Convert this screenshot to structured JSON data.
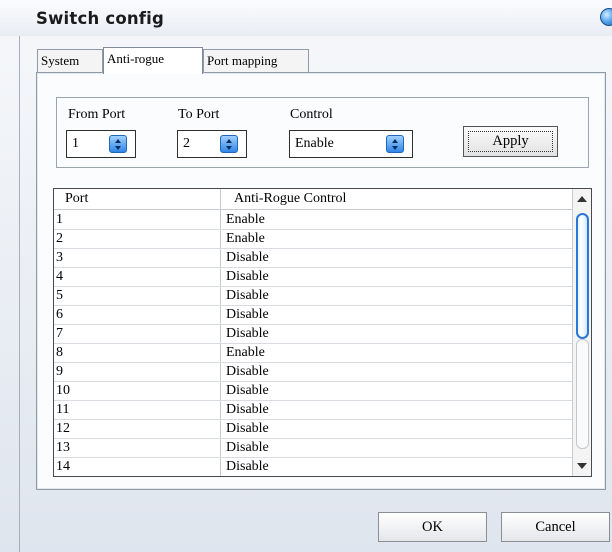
{
  "window": {
    "title": "Switch config"
  },
  "tabs": [
    {
      "label": "System",
      "active": false
    },
    {
      "label": "Anti-rogue",
      "active": true
    },
    {
      "label": "Port mapping",
      "active": false
    }
  ],
  "form": {
    "from_port_label": "From Port",
    "from_port_value": "1",
    "to_port_label": "To Port",
    "to_port_value": "2",
    "control_label": "Control",
    "control_value": "Enable",
    "apply_label": "Apply"
  },
  "table": {
    "headers": [
      "Port",
      "Anti-Rogue Control"
    ],
    "rows": [
      [
        "1",
        "Enable"
      ],
      [
        "2",
        "Enable"
      ],
      [
        "3",
        "Disable"
      ],
      [
        "4",
        "Disable"
      ],
      [
        "5",
        "Disable"
      ],
      [
        "6",
        "Disable"
      ],
      [
        "7",
        "Disable"
      ],
      [
        "8",
        "Enable"
      ],
      [
        "9",
        "Disable"
      ],
      [
        "10",
        "Disable"
      ],
      [
        "11",
        "Disable"
      ],
      [
        "12",
        "Disable"
      ],
      [
        "13",
        "Disable"
      ],
      [
        "14",
        "Disable"
      ]
    ]
  },
  "buttons": {
    "ok": "OK",
    "cancel": "Cancel"
  },
  "colors": {
    "accent": "#2a77d6",
    "border": "#8f9aa8"
  }
}
